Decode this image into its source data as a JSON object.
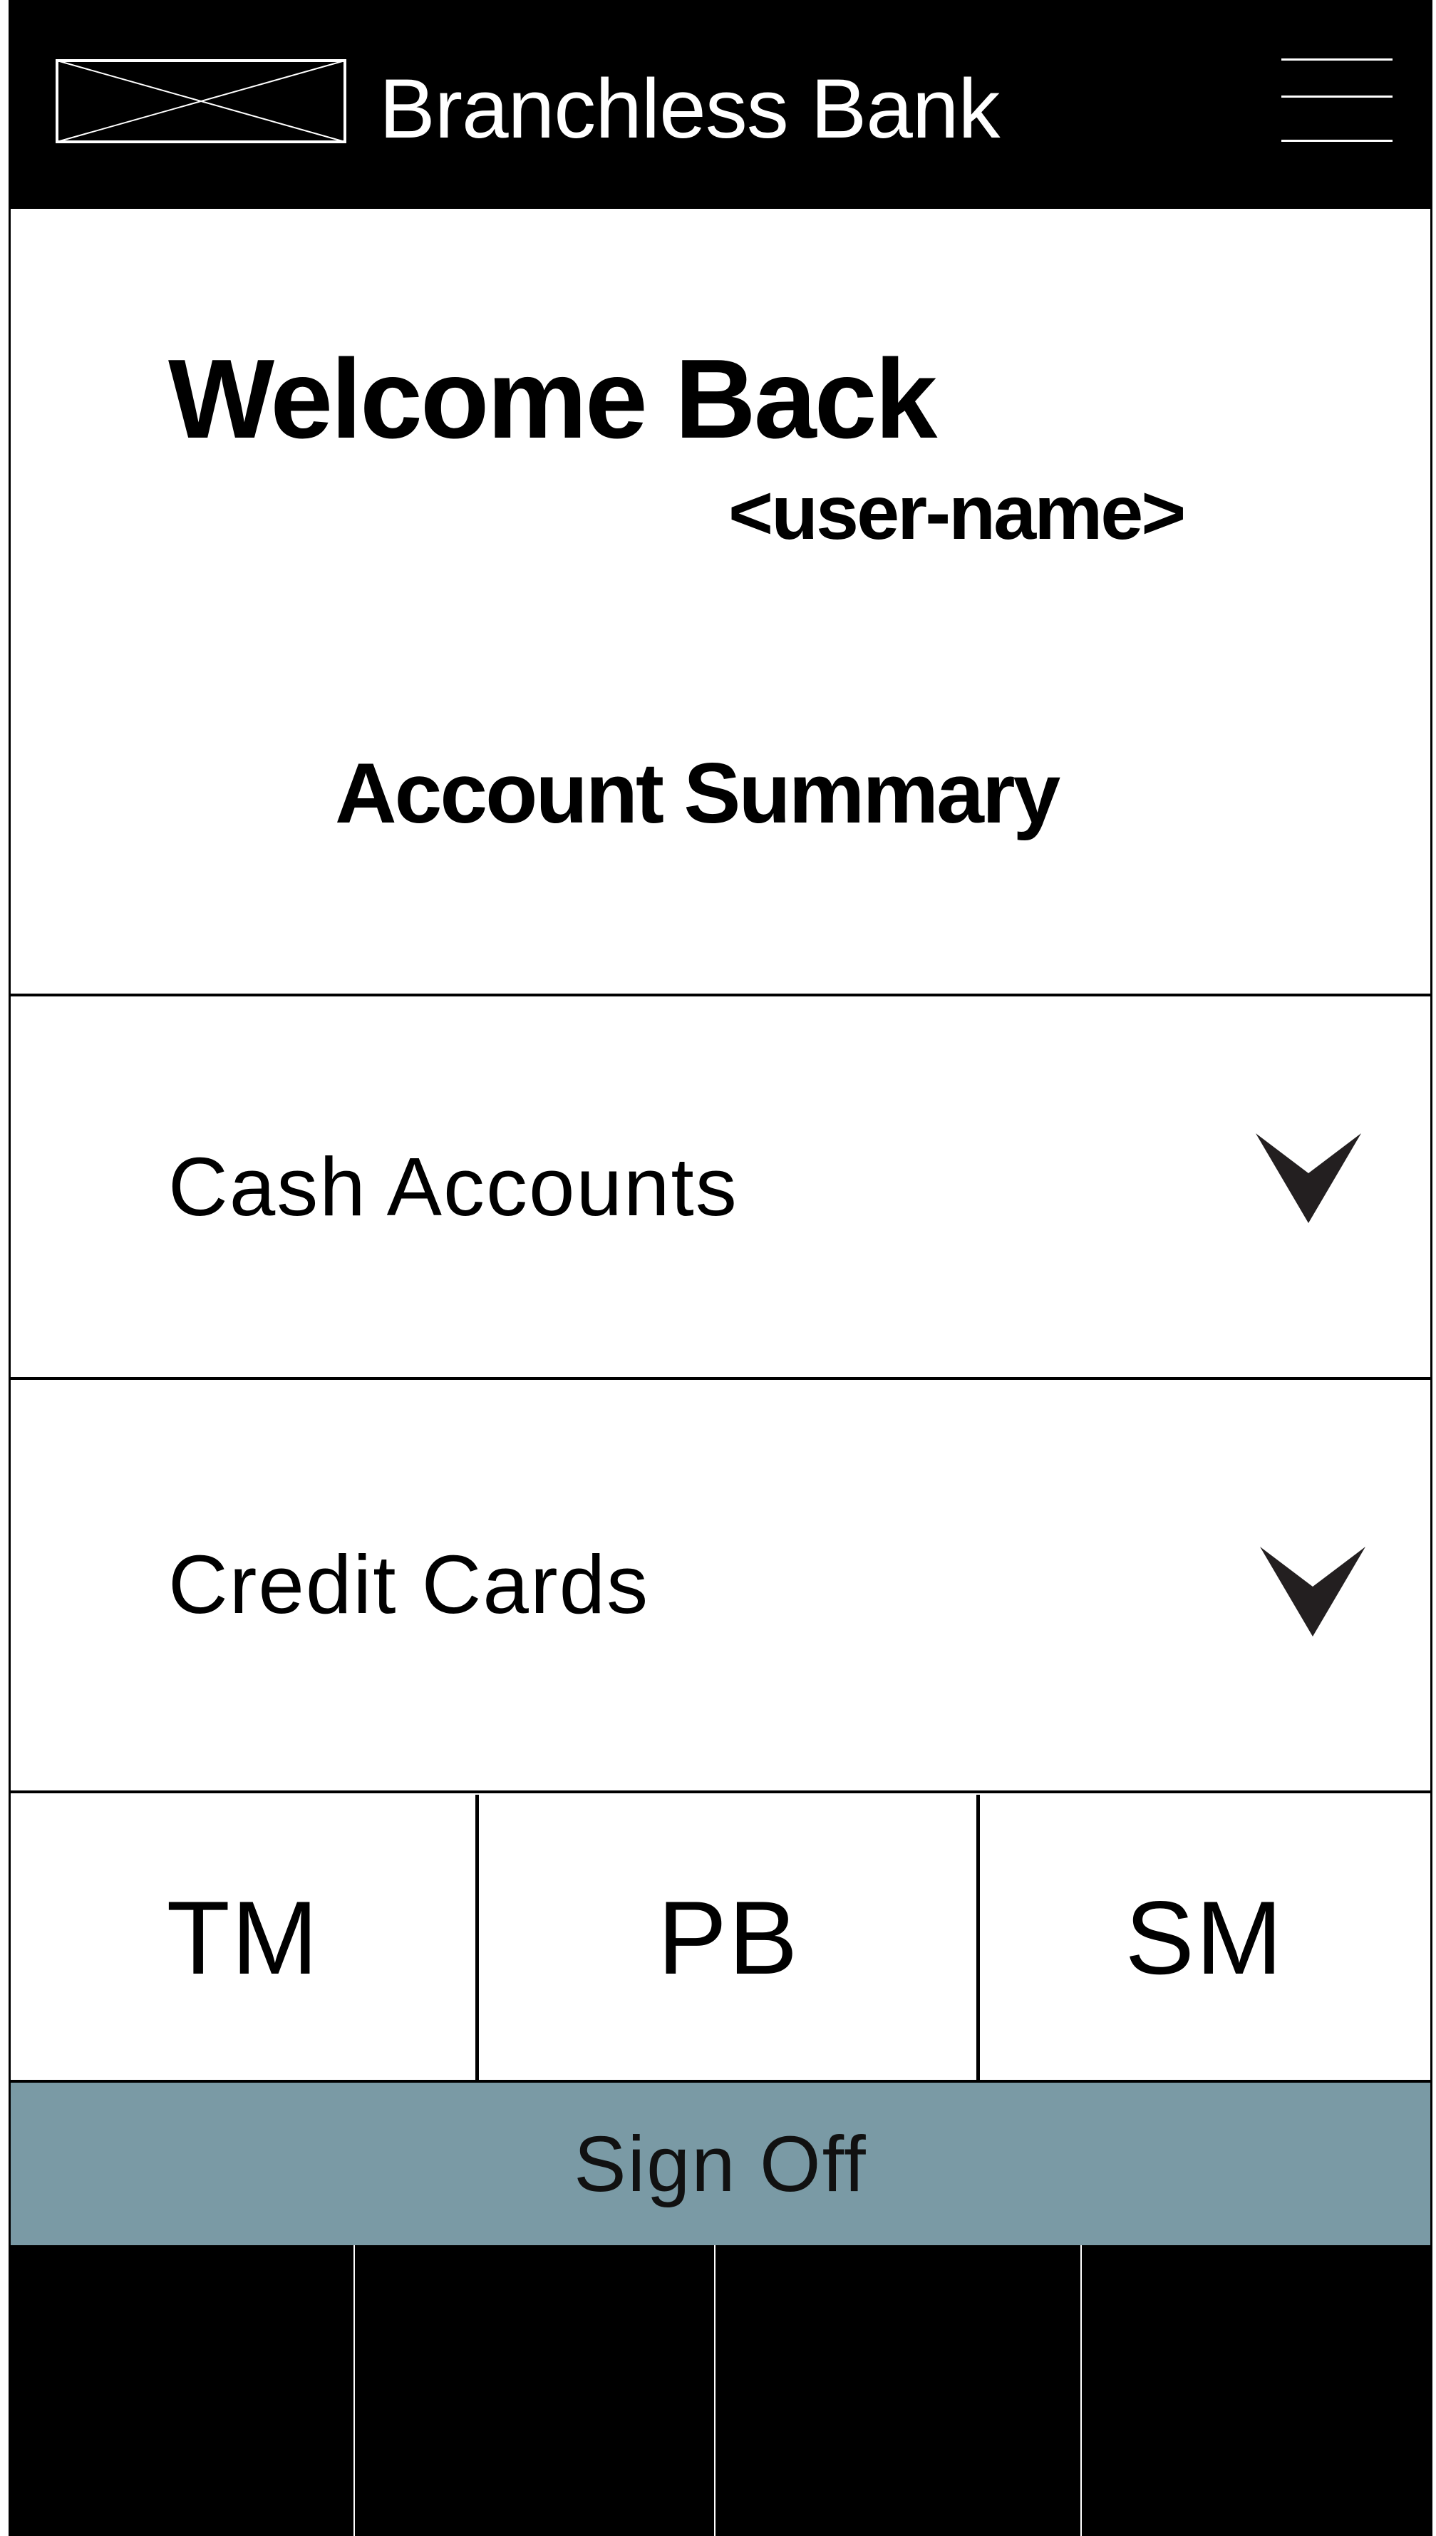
{
  "header": {
    "title": "Branchless Bank",
    "logo_icon": "image-placeholder-icon",
    "menu_icon": "hamburger-menu-icon"
  },
  "welcome": {
    "title": "Welcome Back",
    "user_name": "<user-name>"
  },
  "summary": {
    "title": "Account Summary"
  },
  "accounts": [
    {
      "label": "Cash Accounts",
      "icon": "chevron-down-icon"
    },
    {
      "label": "Credit Cards",
      "icon": "chevron-down-icon"
    }
  ],
  "quick_actions": [
    {
      "label": "TM"
    },
    {
      "label": "PB"
    },
    {
      "label": "SM"
    }
  ],
  "sign_off": {
    "label": "Sign Off",
    "color": "#7a9aa5"
  },
  "colors": {
    "header_bg": "#000000",
    "page_bg": "#ffffff"
  }
}
